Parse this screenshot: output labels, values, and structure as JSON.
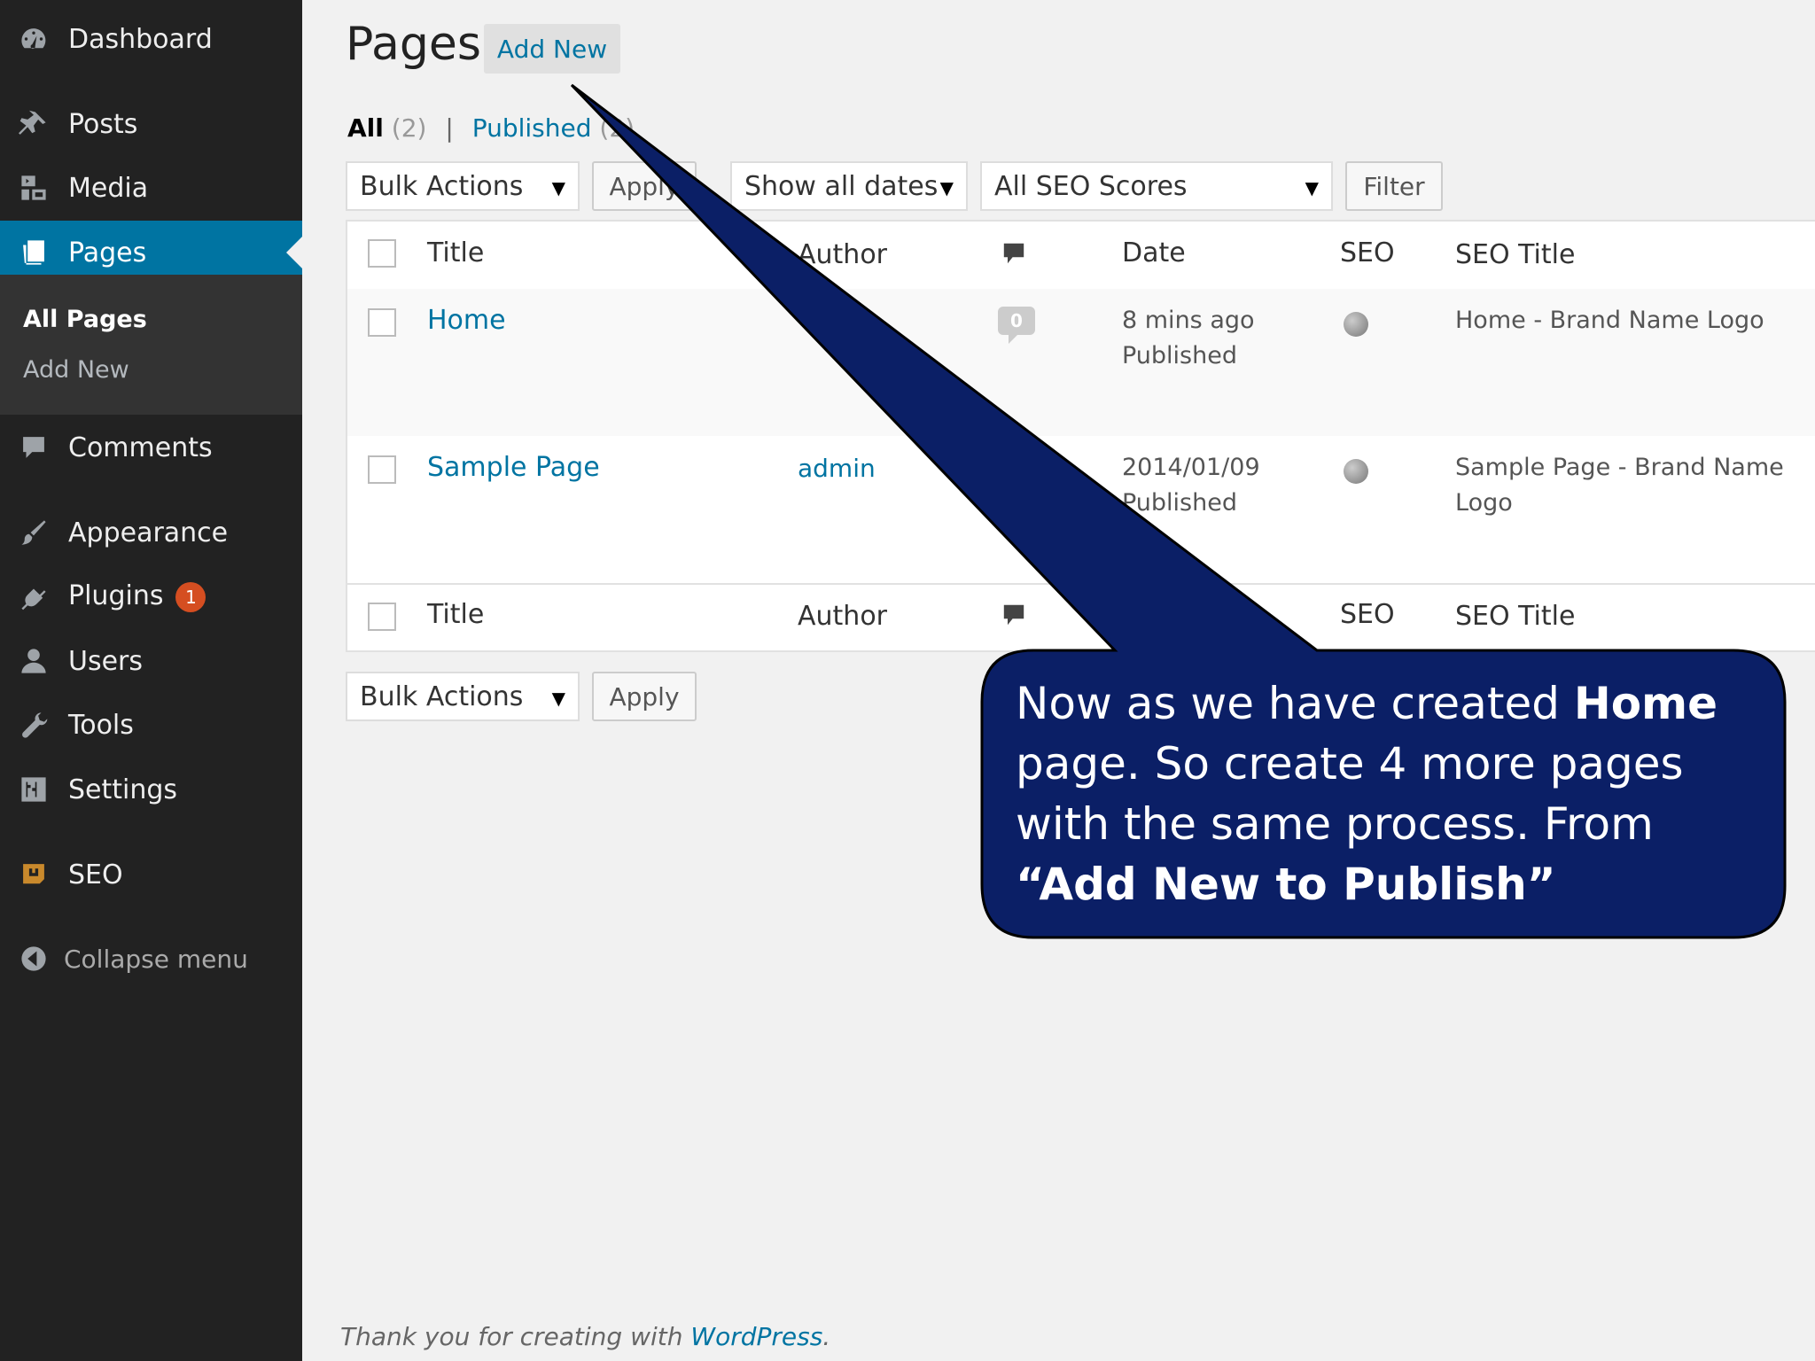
{
  "sidebar": {
    "dashboard": "Dashboard",
    "posts": "Posts",
    "media": "Media",
    "pages": "Pages",
    "submenu": {
      "all_pages": "All Pages",
      "add_new": "Add New"
    },
    "comments": "Comments",
    "appearance": "Appearance",
    "plugins": "Plugins",
    "plugins_badge": "1",
    "users": "Users",
    "tools": "Tools",
    "settings": "Settings",
    "seo": "SEO",
    "collapse": "Collapse menu"
  },
  "header": {
    "title": "Pages",
    "add_new": "Add New"
  },
  "filters_links": {
    "all_label": "All",
    "all_count": "(2)",
    "published_label": "Published",
    "published_count": "(2)",
    "separator": "|"
  },
  "toolbar": {
    "bulk_actions": "Bulk Actions",
    "apply": "Apply",
    "dates": "Show all dates",
    "seo_scores": "All SEO Scores",
    "filter": "Filter"
  },
  "table": {
    "columns": {
      "title": "Title",
      "author": "Author",
      "date": "Date",
      "seo": "SEO",
      "seo_title": "SEO Title"
    },
    "rows": [
      {
        "title": "Home",
        "author": "",
        "comments": "0",
        "date": "8 mins ago",
        "status": "Published",
        "seo_title": "Home - Brand Name Logo"
      },
      {
        "title": "Sample Page",
        "author": "admin",
        "comments": "",
        "date": "2014/01/09",
        "status": "Published",
        "seo_title": "Sample Page - Brand Name Logo"
      }
    ]
  },
  "bottom_toolbar": {
    "bulk_actions": "Bulk Actions",
    "apply": "Apply"
  },
  "callout": {
    "t1": "Now as we have created ",
    "b1": "Home",
    "t2": " page. So create 4 more pages with the same process. From ",
    "b2": "“Add New to Publish”",
    "fill": "#0b1f66"
  },
  "footer": {
    "text": "Thank you for creating with ",
    "link": "WordPress",
    "end": "."
  },
  "colors": {
    "sidebar": "#222222",
    "accent": "#0074a2",
    "badge": "#d54e21"
  }
}
